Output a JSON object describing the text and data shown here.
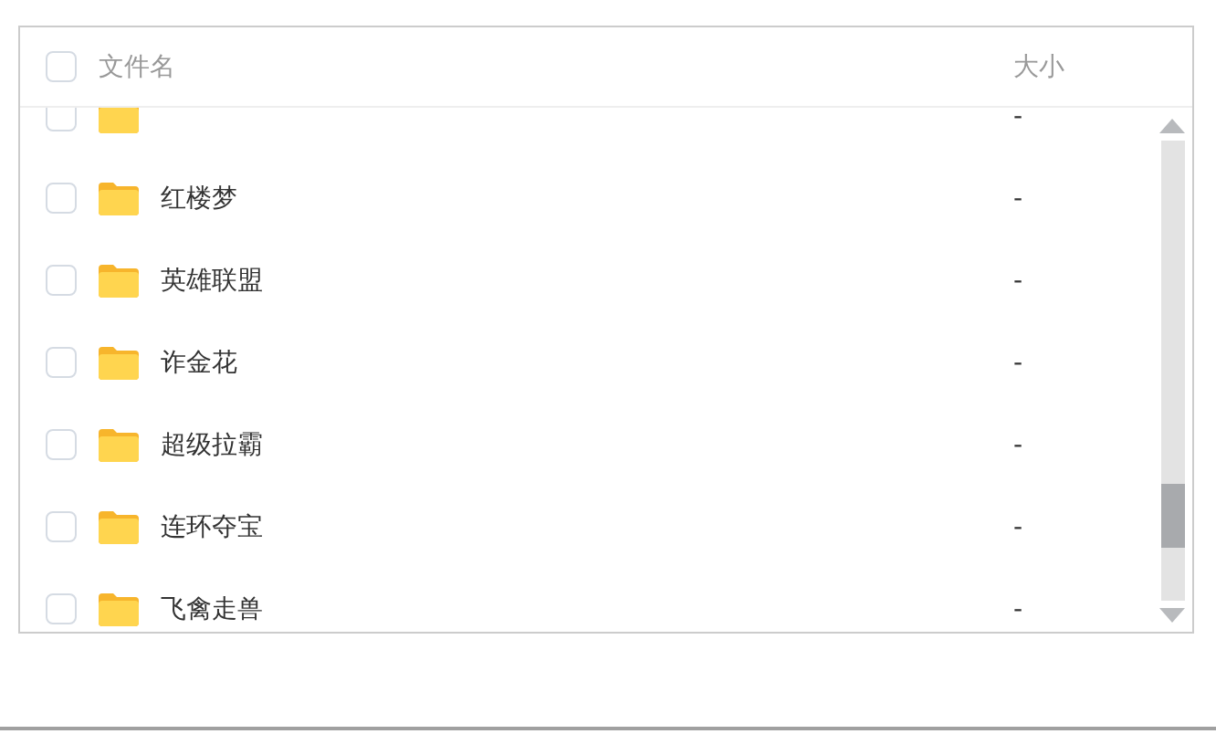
{
  "header": {
    "checked": false,
    "name_label": "文件名",
    "size_label": "大小"
  },
  "rows": [
    {
      "name": "",
      "size": "-",
      "checked": false
    },
    {
      "name": "红楼梦",
      "size": "-",
      "checked": false
    },
    {
      "name": "英雄联盟",
      "size": "-",
      "checked": false
    },
    {
      "name": "诈金花",
      "size": "-",
      "checked": false
    },
    {
      "name": "超级拉霸",
      "size": "-",
      "checked": false
    },
    {
      "name": "连环夺宝",
      "size": "-",
      "checked": false
    },
    {
      "name": "飞禽走兽",
      "size": "-",
      "checked": false
    }
  ]
}
